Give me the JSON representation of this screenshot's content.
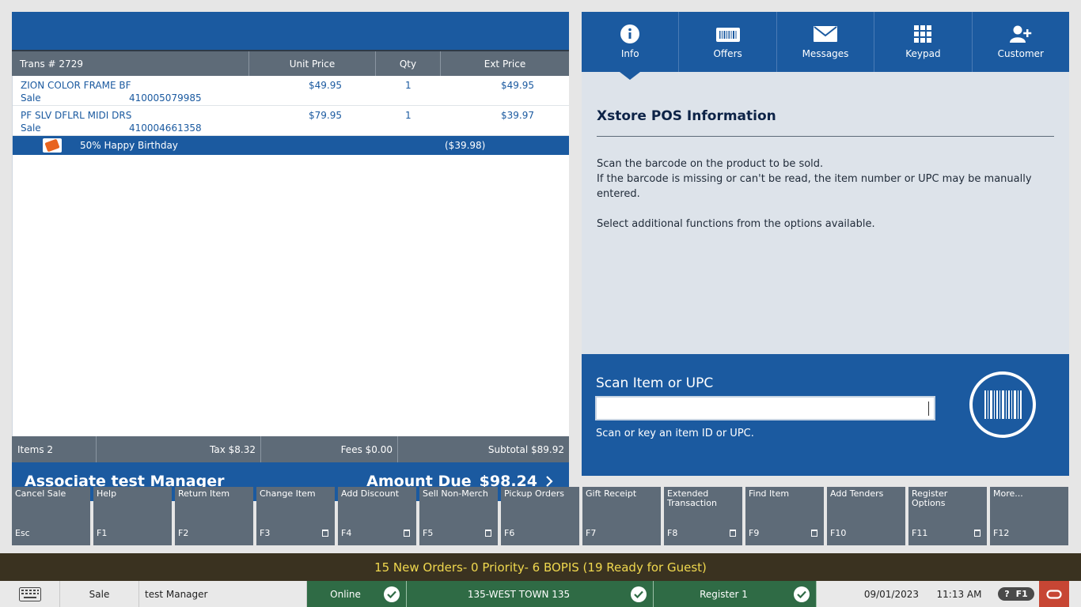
{
  "transaction": {
    "header": {
      "trans_label": "Trans #",
      "trans_number": "2729",
      "unit_price": "Unit Price",
      "qty": "Qty",
      "ext_price": "Ext Price"
    },
    "items": [
      {
        "name": "ZION COLOR FRAME BF",
        "type": "Sale",
        "sku": "410005079985",
        "unit_price": "$49.95",
        "qty": "1",
        "ext_price": "$49.95"
      },
      {
        "name": "PF SLV DFLRL MIDI DRS",
        "type": "Sale",
        "sku": "410004661358",
        "unit_price": "$79.95",
        "qty": "1",
        "ext_price": "$39.97"
      }
    ],
    "discount": {
      "label": "50% Happy Birthday",
      "amount": "($39.98)"
    },
    "totals": {
      "items": "Items 2",
      "tax": "Tax $8.32",
      "fees": "Fees $0.00",
      "subtotal": "Subtotal $89.92"
    },
    "associate": "Associate test Manager",
    "amount_due_label": "Amount Due",
    "amount_due": "$98.24"
  },
  "tabs": [
    {
      "label": "Info",
      "icon": "info-icon"
    },
    {
      "label": "Offers",
      "icon": "offers-icon"
    },
    {
      "label": "Messages",
      "icon": "envelope-icon"
    },
    {
      "label": "Keypad",
      "icon": "keypad-icon"
    },
    {
      "label": "Customer",
      "icon": "add-customer-icon"
    }
  ],
  "info": {
    "title": "Xstore POS Information",
    "line1": "Scan the barcode on the product to be sold.",
    "line2": "If the barcode is missing or can't be read, the item number or UPC may be manually entered.",
    "line3": "Select additional functions from the options available."
  },
  "scan": {
    "label": "Scan Item or UPC",
    "value": "",
    "hint": "Scan or key an item ID or UPC."
  },
  "function_keys": [
    {
      "label": "Cancel Sale",
      "key": "Esc"
    },
    {
      "label": "Help",
      "key": "F1"
    },
    {
      "label": "Return Item",
      "key": "F2"
    },
    {
      "label": "Change Item",
      "key": "F3"
    },
    {
      "label": "Add Discount",
      "key": "F4"
    },
    {
      "label": "Sell Non-Merch",
      "key": "F5"
    },
    {
      "label": "Pickup Orders",
      "key": "F6"
    },
    {
      "label": "Gift Receipt",
      "key": "F7"
    },
    {
      "label": "Extended Transaction",
      "key": "F8"
    },
    {
      "label": "Find Item",
      "key": "F9"
    },
    {
      "label": "Add Tenders",
      "key": "F10"
    },
    {
      "label": "Register Options",
      "key": "F11"
    },
    {
      "label": "More...",
      "key": "F12"
    }
  ],
  "notice": "15 New Orders- 0 Priority- 6 BOPIS (19 Ready for Guest)",
  "status": {
    "mode": "Sale",
    "user": "test Manager",
    "online": "Online",
    "store": "135-WEST TOWN 135",
    "register": "Register 1",
    "date": "09/01/2023",
    "time": "11:13 AM",
    "help_q": "?",
    "help_key": "F1"
  },
  "colors": {
    "primary": "#1b5aa0",
    "panel_gray": "#5e6b78",
    "status_green": "#2f6b45",
    "notice_text": "#f0d84e",
    "oracle_red": "#c74634"
  }
}
